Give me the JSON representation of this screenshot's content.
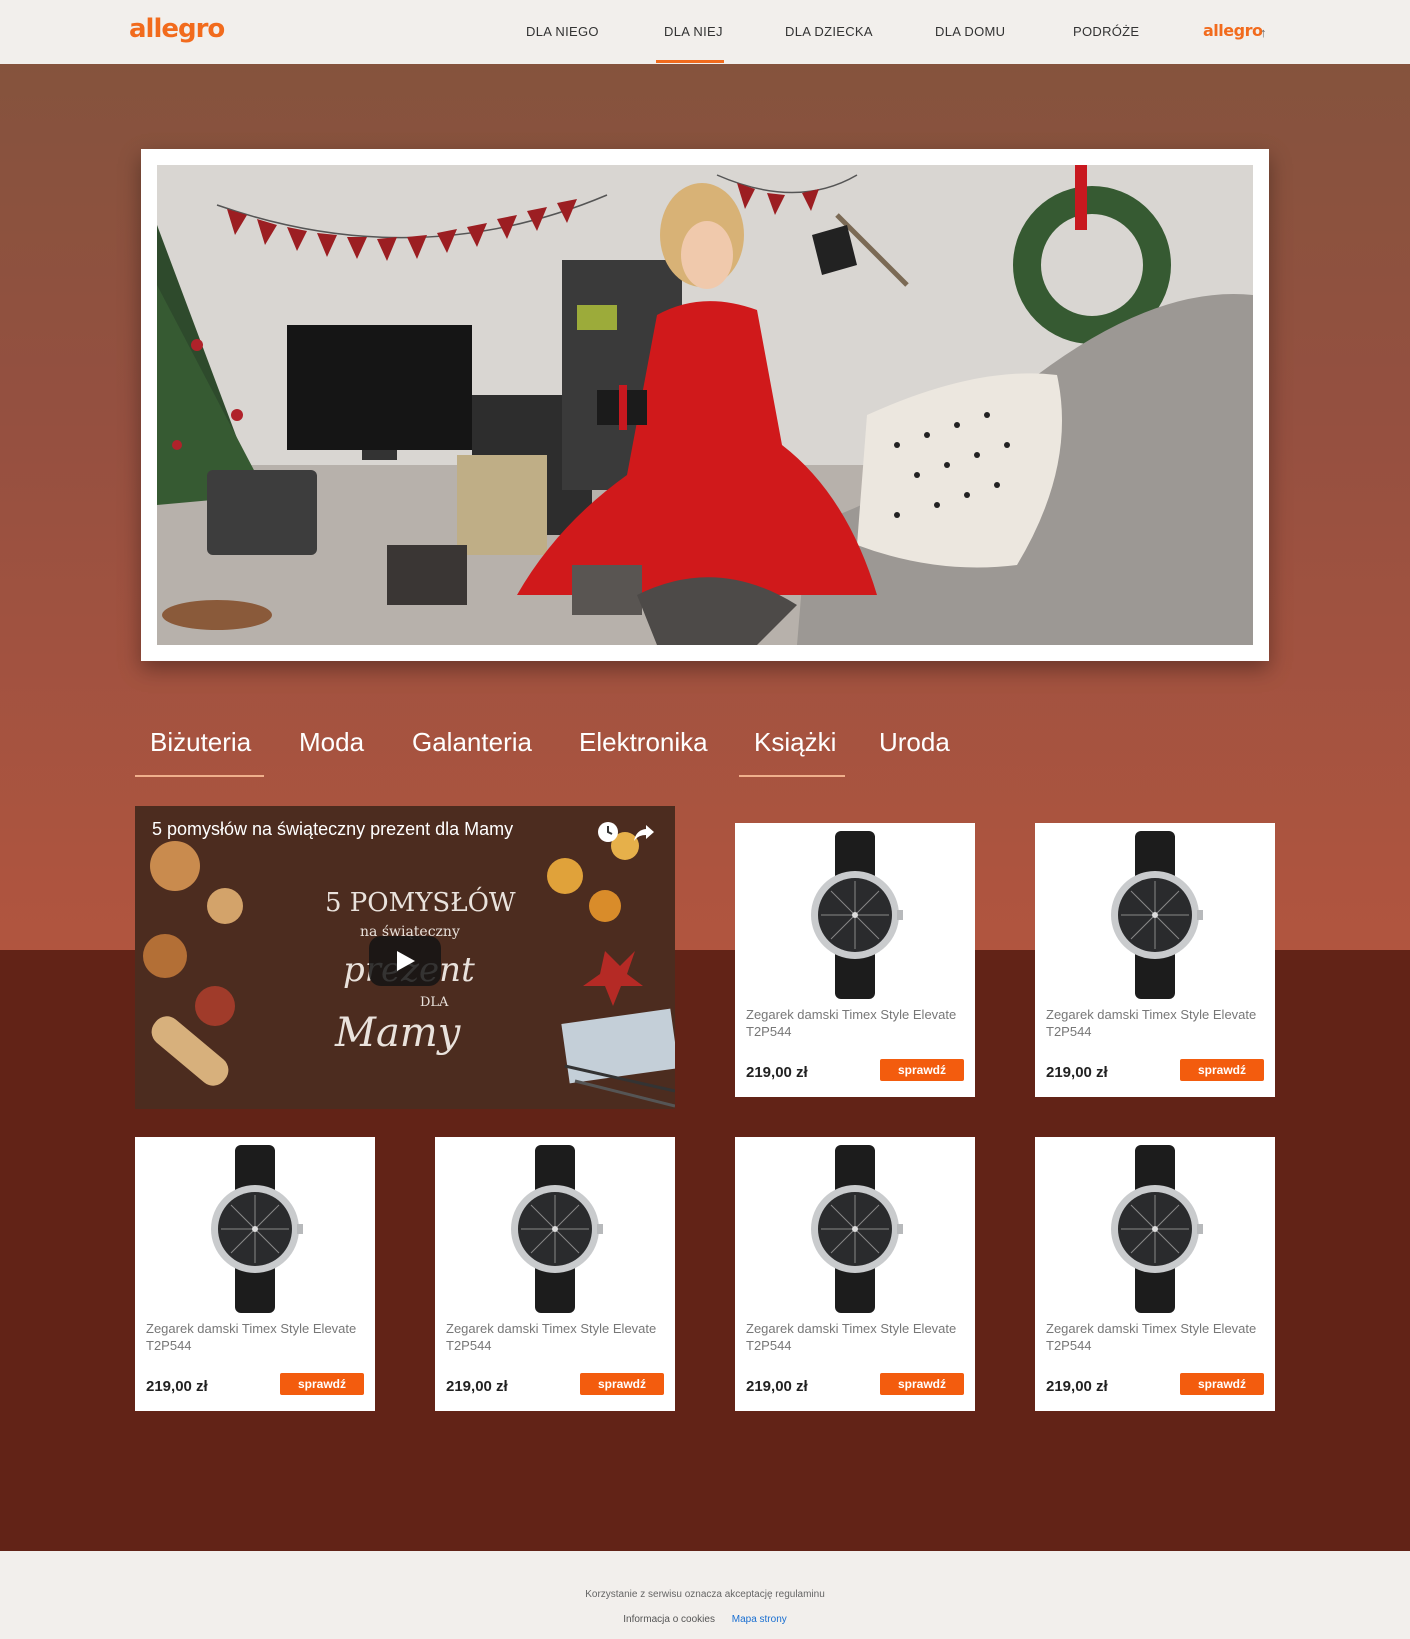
{
  "header": {
    "logo": "allegro",
    "nav": [
      "DLA NIEGO",
      "DLA NIEJ",
      "DLA DZIECKA",
      "DLA DOMU",
      "PODRÓŻE"
    ],
    "active_index": 1,
    "right_logo": "allegro",
    "right_arrow": "↑"
  },
  "hero": {
    "image_subject": "woman-in-red-dress-with-gift-living-room"
  },
  "categories": {
    "tabs": [
      "Biżuteria",
      "Moda",
      "Galanteria",
      "Elektronika",
      "Książki",
      "Uroda"
    ],
    "underlined": [
      0,
      4
    ]
  },
  "video": {
    "title": "5 pomysłów na świąteczny prezent dla Mamy",
    "overlay_text_lines": [
      "5 POMYSŁÓW",
      "na świąteczny",
      "prezent",
      "DLA",
      "Mamy"
    ]
  },
  "products": [
    {
      "name": "Zegarek damski Timex Style Elevate T2P544",
      "price": "219,00 zł",
      "button": "sprawdź"
    },
    {
      "name": "Zegarek damski Timex Style Elevate T2P544",
      "price": "219,00 zł",
      "button": "sprawdź"
    },
    {
      "name": "Zegarek damski Timex Style Elevate T2P544",
      "price": "219,00 zł",
      "button": "sprawdź"
    },
    {
      "name": "Zegarek damski Timex Style Elevate T2P544",
      "price": "219,00 zł",
      "button": "sprawdź"
    },
    {
      "name": "Zegarek damski Timex Style Elevate T2P544",
      "price": "219,00 zł",
      "button": "sprawdź"
    },
    {
      "name": "Zegarek damski Timex Style Elevate T2P544",
      "price": "219,00 zł",
      "button": "sprawdź"
    }
  ],
  "footer": {
    "notice": "Korzystanie z serwisu oznacza akceptację regulaminu",
    "links": [
      "Informacja o cookies",
      "Mapa strony"
    ]
  },
  "colors": {
    "accent": "#f26b1d",
    "button": "#f35c0e",
    "top_bg": "#a4533f",
    "bottom_bg": "#622317",
    "link_blue": "#1a6fd1"
  }
}
